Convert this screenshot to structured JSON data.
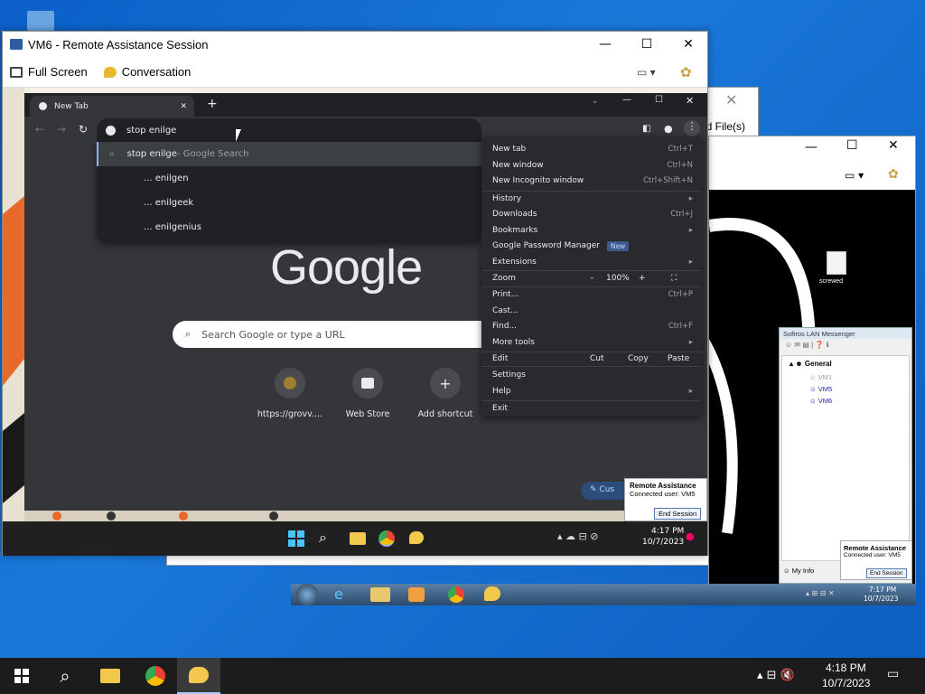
{
  "vm6": {
    "title": "VM6 - Remote Assistance Session",
    "toolbar": {
      "full_screen": "Full Screen",
      "conversation": "Conversation"
    }
  },
  "behind_window": {
    "partial_label": "nd File(s)"
  },
  "chrome": {
    "tab_title": "New Tab",
    "omnibox_value": "stop enilge",
    "suggestions": [
      {
        "text": "stop enilge",
        "suffix": " - Google Search"
      },
      {
        "text": "... enilgen"
      },
      {
        "text": "... enilgeek"
      },
      {
        "text": "... enilgenius"
      }
    ],
    "logo": "Google",
    "search_placeholder": "Search Google or type a URL",
    "shortcuts": [
      {
        "label": "https://grovv...."
      },
      {
        "label": "Web Store"
      },
      {
        "label": "Add shortcut"
      }
    ],
    "customize_partial": "Cus",
    "menu": {
      "new_tab": {
        "label": "New tab",
        "shortcut": "Ctrl+T"
      },
      "new_window": {
        "label": "New window",
        "shortcut": "Ctrl+N"
      },
      "new_incognito": {
        "label": "New Incognito window",
        "shortcut": "Ctrl+Shift+N"
      },
      "history": {
        "label": "History"
      },
      "downloads": {
        "label": "Downloads",
        "shortcut": "Ctrl+J"
      },
      "bookmarks": {
        "label": "Bookmarks"
      },
      "password_manager": {
        "label": "Google Password Manager",
        "badge": "New"
      },
      "extensions": {
        "label": "Extensions"
      },
      "zoom": {
        "label": "Zoom",
        "minus": "–",
        "value": "100%",
        "plus": "+"
      },
      "print": {
        "label": "Print...",
        "shortcut": "Ctrl+P"
      },
      "cast": {
        "label": "Cast..."
      },
      "find": {
        "label": "Find...",
        "shortcut": "Ctrl+F"
      },
      "more_tools": {
        "label": "More tools"
      },
      "edit": {
        "label": "Edit",
        "cut": "Cut",
        "copy": "Copy",
        "paste": "Paste"
      },
      "settings": {
        "label": "Settings"
      },
      "help": {
        "label": "Help"
      },
      "exit": {
        "label": "Exit"
      }
    }
  },
  "vm6_taskbar": {
    "time": "4:17 PM",
    "date": "10/7/2023"
  },
  "ra_vm6": {
    "title": "Remote Assistance",
    "user": "Connected user: VM5",
    "end_button": "End Session"
  },
  "vm5_desktop": {
    "file_label": "screwed"
  },
  "lan_messenger": {
    "title": "Softros LAN Messenger",
    "group": "General",
    "users": [
      "VM1",
      "VM5",
      "VM6"
    ],
    "my_info": "My Info"
  },
  "ra_vm5": {
    "title": "Remote Assistance",
    "user": "Connected user: VM5",
    "end_button": "End Session"
  },
  "vm5_taskbar": {
    "time": "7:17 PM",
    "date": "10/7/2023"
  },
  "host_taskbar": {
    "time": "4:18 PM",
    "date": "10/7/2023"
  }
}
